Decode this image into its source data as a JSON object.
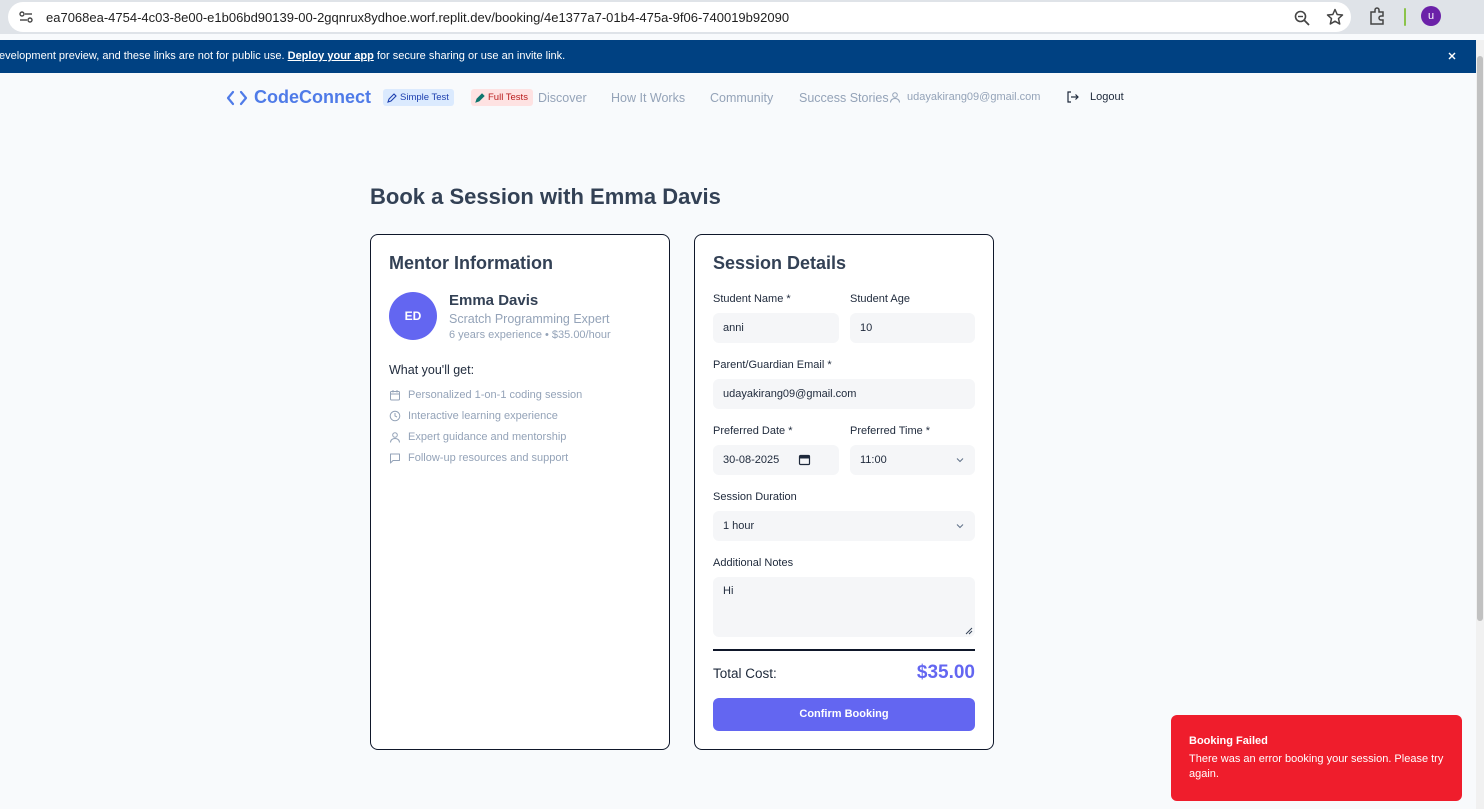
{
  "browser": {
    "url": "ea7068ea-4754-4c03-8e00-e1b06bd90139-00-2gqnrux8ydhoe.worf.replit.dev/booking/4e1377a7-01b4-475a-9f06-740019b92090",
    "profile_initial": "u"
  },
  "banner": {
    "text_before": "evelopment preview, and these links are not for public use.",
    "link": "Deploy your app",
    "text_after": "for secure sharing or use an invite link."
  },
  "nav": {
    "brand": "CodeConnect",
    "simple_test": "Simple Test",
    "full_tests": "Full Tests",
    "links": [
      "Discover",
      "How It Works",
      "Community",
      "Success Stories"
    ],
    "user_email": "udayakirang09@gmail.com",
    "logout": "Logout"
  },
  "page": {
    "title": "Book a Session with Emma Davis"
  },
  "mentor": {
    "heading": "Mentor Information",
    "initials": "ED",
    "name": "Emma Davis",
    "specialty": "Scratch Programming Expert",
    "meta": "6 years experience • $35.00/hour",
    "benefits_heading": "What you'll get:",
    "benefits": [
      "Personalized 1-on-1 coding session",
      "Interactive learning experience",
      "Expert guidance and mentorship",
      "Follow-up resources and support"
    ]
  },
  "session": {
    "heading": "Session Details",
    "student_name_label": "Student Name *",
    "student_name_value": "anni",
    "student_age_label": "Student Age",
    "student_age_value": "10",
    "email_label": "Parent/Guardian Email *",
    "email_value": "udayakirang09@gmail.com",
    "date_label": "Preferred Date *",
    "date_value": "30-08-2025",
    "time_label": "Preferred Time *",
    "time_value": "11:00",
    "duration_label": "Session Duration",
    "duration_value": "1 hour",
    "notes_label": "Additional Notes",
    "notes_value": "Hi",
    "total_label": "Total Cost:",
    "total_value": "$35.00",
    "confirm": "Confirm Booking"
  },
  "toast": {
    "title": "Booking Failed",
    "message": "There was an error booking your session. Please try again."
  },
  "colors": {
    "brand": "#4f7be8",
    "accent": "#6366f1",
    "error": "#ef1d2c",
    "banner": "#004182"
  }
}
